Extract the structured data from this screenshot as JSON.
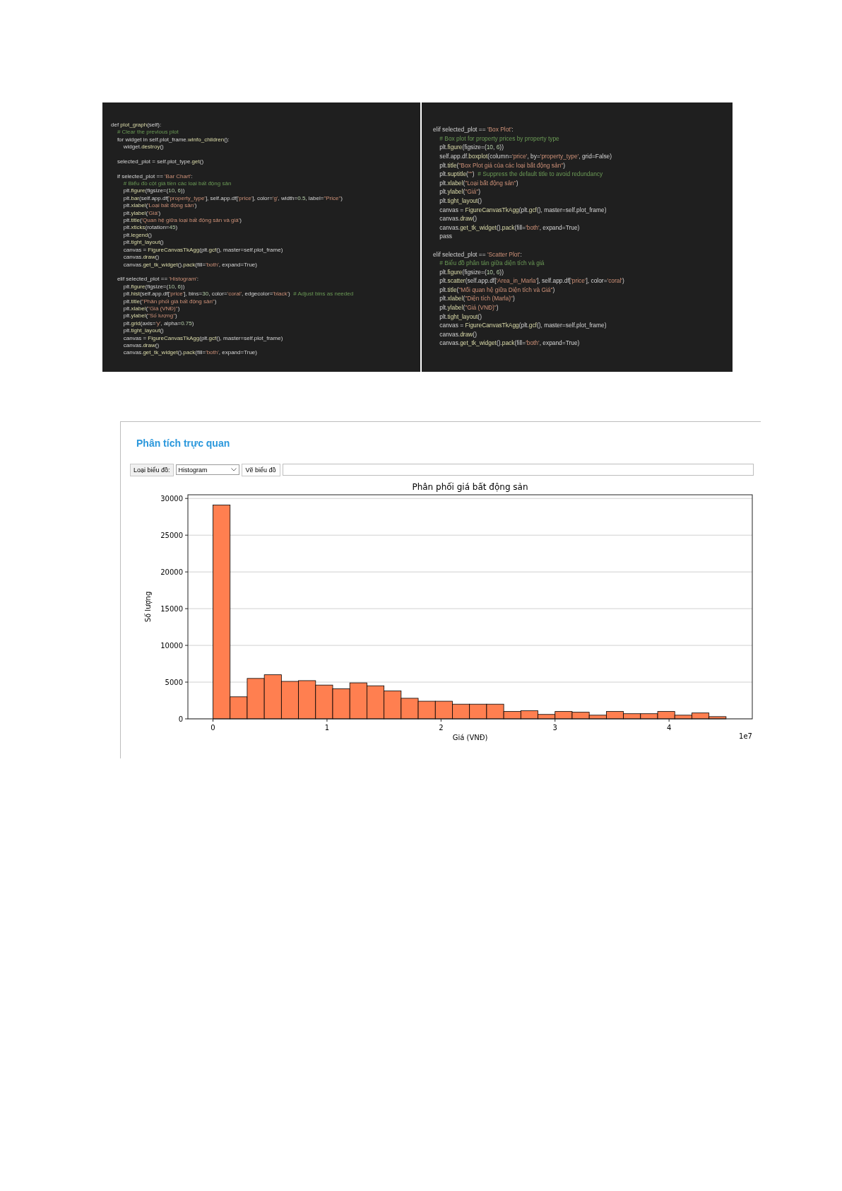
{
  "code_panels": [
    {
      "lines": [
        {
          "text": "def plot_graph(self):"
        },
        {
          "text": "    # Clear the previous plot"
        },
        {
          "text": "    for widget in self.plot_frame.winfo_children():"
        },
        {
          "text": "        widget.destroy()"
        },
        {
          "text": "    selected_plot = self.plot_type.get()",
          "blank_before": true
        },
        {
          "text": "    if selected_plot == 'Bar Chart':",
          "blank_before": true
        },
        {
          "text": "        # Biểu đồ cột giá tiền các loại bất động sản"
        },
        {
          "text": "        plt.figure(figsize=(10, 6))"
        },
        {
          "text": "        plt.bar(self.app.df['property_type'], self.app.df['price'], color='g', width=0.5, label=\"Price\")"
        },
        {
          "text": "        plt.xlabel('Loại bất động sản')"
        },
        {
          "text": "        plt.ylabel('Giá')"
        },
        {
          "text": "        plt.title('Quan hệ giữa loại bất động sản và giá')"
        },
        {
          "text": "        plt.xticks(rotation=45)"
        },
        {
          "text": "        plt.legend()"
        },
        {
          "text": "        plt.tight_layout()"
        },
        {
          "text": "        canvas = FigureCanvasTkAgg(plt.gcf(), master=self.plot_frame)"
        },
        {
          "text": "        canvas.draw()"
        },
        {
          "text": "        canvas.get_tk_widget().pack(fill='both', expand=True)"
        },
        {
          "text": "    elif selected_plot == 'Histogram':",
          "blank_before": true
        },
        {
          "text": "        plt.figure(figsize=(10, 6))"
        },
        {
          "text": "        plt.hist(self.app.df['price'], bins=30, color='coral', edgecolor='black')  # Adjust bins as needed"
        },
        {
          "text": "        plt.title(\"Phân phối giá bất động sản\")"
        },
        {
          "text": "        plt.xlabel(\"Giá (VNĐ)\")"
        },
        {
          "text": "        plt.ylabel(\"Số lượng\")"
        },
        {
          "text": "        plt.grid(axis='y', alpha=0.75)"
        },
        {
          "text": "        plt.tight_layout()"
        },
        {
          "text": "        canvas = FigureCanvasTkAgg(plt.gcf(), master=self.plot_frame)"
        },
        {
          "text": "        canvas.draw()"
        },
        {
          "text": "        canvas.get_tk_widget().pack(fill='both', expand=True)"
        }
      ]
    },
    {
      "lines": [
        {
          "text": "elif selected_plot == 'Box Plot':"
        },
        {
          "text": "    # Box plot for property prices by property type"
        },
        {
          "text": "    plt.figure(figsize=(10, 6))"
        },
        {
          "text": "    self.app.df.boxplot(column='price', by='property_type', grid=False)"
        },
        {
          "text": "    plt.title(\"Box Plot giá của các loại bất động sản\")"
        },
        {
          "text": "    plt.suptitle(\"\")  # Suppress the default title to avoid redundancy"
        },
        {
          "text": "    plt.xlabel(\"Loại bất động sản\")"
        },
        {
          "text": "    plt.ylabel(\"Giá\")"
        },
        {
          "text": "    plt.tight_layout()"
        },
        {
          "text": "    canvas = FigureCanvasTkAgg(plt.gcf(), master=self.plot_frame)"
        },
        {
          "text": "    canvas.draw()"
        },
        {
          "text": "    canvas.get_tk_widget().pack(fill='both', expand=True)"
        },
        {
          "text": "    pass"
        },
        {
          "text": "elif selected_plot == 'Scatter Plot':",
          "blank_before": true
        },
        {
          "text": "    # Biểu đồ phân tán giữa diện tích và giá"
        },
        {
          "text": "    plt.figure(figsize=(10, 6))"
        },
        {
          "text": "    plt.scatter(self.app.df['Area_in_Marla'], self.app.df['price'], color='coral')"
        },
        {
          "text": "    plt.title(\"Mối quan hệ giữa Diện tích và Giá\")"
        },
        {
          "text": "    plt.xlabel(\"Diện tích (Marla)\")"
        },
        {
          "text": "    plt.ylabel(\"Giá (VNĐ)\")"
        },
        {
          "text": "    plt.tight_layout()"
        },
        {
          "text": "    canvas = FigureCanvasTkAgg(plt.gcf(), master=self.plot_frame)"
        },
        {
          "text": "    canvas.draw()"
        },
        {
          "text": "    canvas.get_tk_widget().pack(fill='both', expand=True)"
        }
      ]
    }
  ],
  "app": {
    "heading": "Phân tích trực quan",
    "toolbar": {
      "label": "Loại biểu đồ:",
      "plot_type": {
        "value": "Histogram"
      },
      "draw_button": "Vẽ biểu đồ"
    },
    "x_offset_label": "1e7",
    "chart_data": {
      "type": "bar",
      "title": "Phân phối giá bất động sản",
      "xlabel": "Giá (VNĐ)",
      "ylabel": "Số lượng",
      "x": [
        0.075,
        0.225,
        0.375,
        0.525,
        0.675,
        0.825,
        0.975,
        1.125,
        1.275,
        1.425,
        1.575,
        1.725,
        1.875,
        2.025,
        2.175,
        2.325,
        2.475,
        2.625,
        2.775,
        2.925,
        3.075,
        3.225,
        3.375,
        3.525,
        3.675,
        3.825,
        3.975,
        4.125,
        4.275,
        4.425
      ],
      "grid": true,
      "series": [
        {
          "color": "#ff7f50",
          "values": [
            29100,
            3000,
            5500,
            6000,
            5100,
            5200,
            4600,
            4100,
            4900,
            4500,
            3800,
            2800,
            2400,
            2400,
            2000,
            2000,
            2000,
            1000,
            1100,
            600,
            1000,
            900,
            500,
            1000,
            700,
            700,
            1000,
            500,
            800,
            300
          ]
        }
      ],
      "xlim": [
        -0.22,
        4.73
      ],
      "ylim": [
        0,
        30500
      ],
      "xticks": [
        {
          "value": 0,
          "label": "0"
        },
        {
          "value": 1,
          "label": "1"
        },
        {
          "value": 2,
          "label": "2"
        },
        {
          "value": 3,
          "label": "3"
        },
        {
          "value": 4,
          "label": "4"
        }
      ],
      "yticks": [
        {
          "value": 0,
          "label": "0"
        },
        {
          "value": 5000,
          "label": "5000"
        },
        {
          "value": 10000,
          "label": "10000"
        },
        {
          "value": 15000,
          "label": "15000"
        },
        {
          "value": 20000,
          "label": "20000"
        },
        {
          "value": 25000,
          "label": "25000"
        },
        {
          "value": 30000,
          "label": "30000"
        }
      ]
    }
  }
}
